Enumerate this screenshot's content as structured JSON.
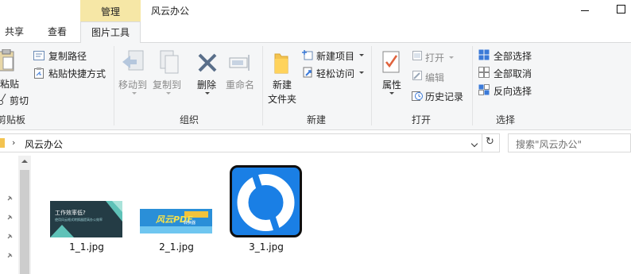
{
  "titlebar": {
    "context_group": "管理",
    "window_title": "风云办公"
  },
  "tabs": [
    {
      "label": "共享"
    },
    {
      "label": "查看"
    },
    {
      "label": "图片工具"
    }
  ],
  "ribbon": {
    "clipboard": {
      "group_label": "剪贴板",
      "paste": "粘贴",
      "copy_path": "复制路径",
      "paste_shortcut": "粘贴快捷方式",
      "cut": "剪切"
    },
    "organize": {
      "group_label": "组织",
      "move_to": "移动到",
      "copy_to": "复制到",
      "delete": "删除",
      "rename": "重命名"
    },
    "new": {
      "group_label": "新建",
      "new_folder_line1": "新建",
      "new_folder_line2": "文件夹",
      "new_item": "新建项目",
      "easy_access": "轻松访问"
    },
    "open": {
      "group_label": "打开",
      "properties": "属性",
      "open": "打开",
      "edit": "编辑",
      "history": "历史记录"
    },
    "select": {
      "group_label": "选择",
      "select_all": "全部选择",
      "select_none": "全部取消",
      "invert": "反向选择"
    }
  },
  "address": {
    "path": "风云办公",
    "search_placeholder": "搜索\"风云办公\""
  },
  "files": [
    {
      "name": "1_1.jpg",
      "thumb_line1": "工作效率低?",
      "thumb_line2": "使用风云格式转换器提高办公效率"
    },
    {
      "name": "2_1.jpg",
      "thumb_line1": "风云PDF",
      "thumb_line2": "转换器"
    },
    {
      "name": "3_1.jpg"
    }
  ],
  "colors": {
    "ribbon_bg": "#f5f6f7",
    "context_tab": "#f6e7a6",
    "folder_yellow": "#f3c350",
    "app_blue": "#1a7fe5"
  }
}
